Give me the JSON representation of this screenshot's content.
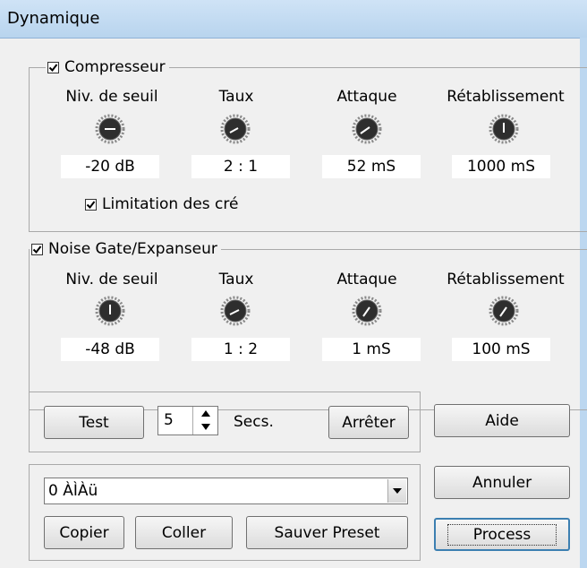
{
  "window": {
    "title": "Dynamique"
  },
  "compressor": {
    "legend": "Compresseur",
    "checked": true,
    "knobs": [
      {
        "label": "Niv. de seuil",
        "value": "-20 dB"
      },
      {
        "label": "Taux",
        "value": "2 : 1"
      },
      {
        "label": "Attaque",
        "value": "52 mS"
      },
      {
        "label": "Rétablissement",
        "value": "1000 mS"
      }
    ],
    "limit_label": "Limitation des cré",
    "limit_checked": true
  },
  "gate": {
    "legend": "Noise Gate/Expanseur",
    "checked": true,
    "knobs": [
      {
        "label": "Niv. de seuil",
        "value": "-48 dB"
      },
      {
        "label": "Taux",
        "value": "1 : 2"
      },
      {
        "label": "Attaque",
        "value": "1 mS"
      },
      {
        "label": "Rétablissement",
        "value": "100 mS"
      }
    ]
  },
  "test": {
    "test_label": "Test",
    "seconds_value": "5",
    "seconds_unit": "Secs.",
    "stop_label": "Arrêter"
  },
  "preset": {
    "selected": "0 ÀÌÀü",
    "copy_label": "Copier",
    "paste_label": "Coller",
    "save_label": "Sauver Preset"
  },
  "buttons": {
    "help": "Aide",
    "cancel": "Annuler",
    "process": "Process"
  },
  "colors": {
    "title_bar": "#c4dcf3",
    "knob_face": "#2e2e2e",
    "window_bg": "#f0f0f0"
  }
}
